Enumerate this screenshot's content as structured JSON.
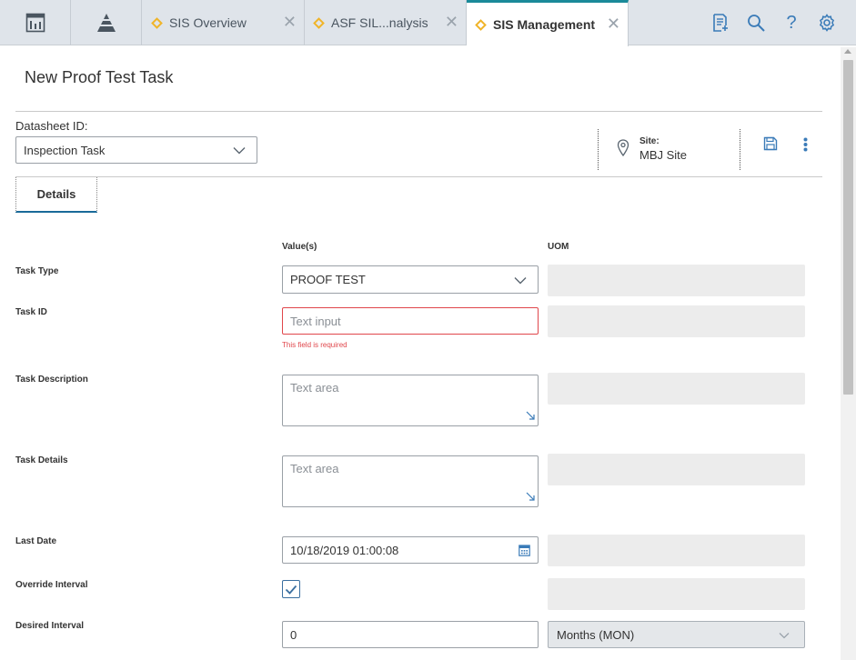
{
  "topbar": {
    "nav_icons": [
      "dashboard-icon",
      "pyramid-icon"
    ],
    "tabs": [
      {
        "label": "SIS Overview",
        "active": false
      },
      {
        "label": "ASF SIL...nalysis",
        "active": false
      },
      {
        "label": "SIS Management",
        "active": true
      }
    ],
    "right_icons": [
      "new-document-icon",
      "search-icon",
      "help-icon",
      "settings-gear-icon"
    ],
    "tab_close_glyph": "✕",
    "help_glyph": "?"
  },
  "page": {
    "title": "New Proof Test Task"
  },
  "datasheet": {
    "label": "Datasheet ID:",
    "value": "Inspection Task"
  },
  "site": {
    "label": "Site:",
    "value": "MBJ Site"
  },
  "tabs": {
    "details": "Details"
  },
  "columns": {
    "values": "Value(s)",
    "uom": "UOM"
  },
  "fields": {
    "task_type": {
      "label": "Task Type",
      "value": "PROOF TEST"
    },
    "task_id": {
      "label": "Task ID",
      "placeholder": "Text input",
      "error": "This field is required"
    },
    "task_description": {
      "label": "Task Description",
      "placeholder": "Text area"
    },
    "task_details": {
      "label": "Task Details",
      "placeholder": "Text area"
    },
    "last_date": {
      "label": "Last Date",
      "value": "10/18/2019 01:00:08"
    },
    "override_interval": {
      "label": "Override Interval",
      "checked": true
    },
    "desired_interval": {
      "label": "Desired Interval",
      "value": "0",
      "uom": "Months (MON)"
    }
  },
  "colors": {
    "accent": "#1a8a99",
    "error": "#e0464b",
    "tab_diamond": "#f0b429",
    "icon_blue": "#3a7bb8"
  }
}
